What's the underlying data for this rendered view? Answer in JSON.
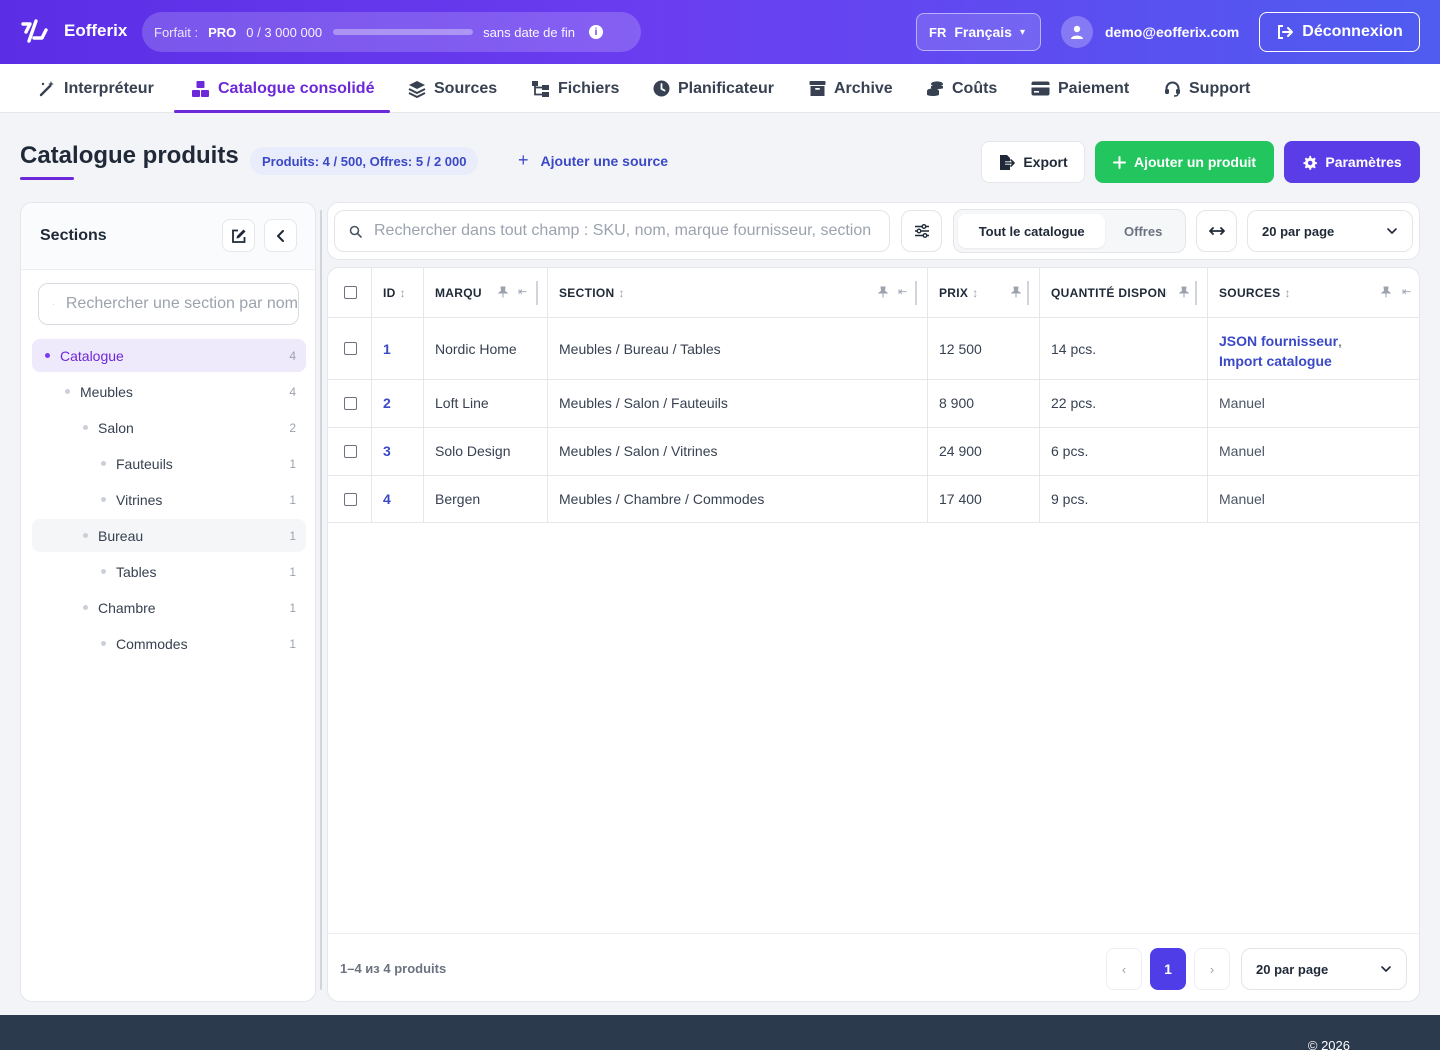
{
  "app": {
    "name": "Eofferix"
  },
  "plan": {
    "label": "Forfait :",
    "tier": "PRO",
    "usage": "0  /  3 000 000",
    "usage_fraction": 0.0,
    "expiry": "sans date de fin",
    "info": "i"
  },
  "lang": {
    "code": "FR",
    "label": "Français",
    "caret": "▾"
  },
  "user": {
    "email": "demo@eofferix.com"
  },
  "logout": {
    "label": "Déconnexion"
  },
  "nav": [
    {
      "label": "Interpréteur",
      "icon": "wand-icon"
    },
    {
      "label": "Catalogue consolidé",
      "icon": "boxes-icon",
      "active": true
    },
    {
      "label": "Sources",
      "icon": "layers-icon"
    },
    {
      "label": "Fichiers",
      "icon": "file-tree-icon"
    },
    {
      "label": "Planificateur",
      "icon": "clock-icon"
    },
    {
      "label": "Archive",
      "icon": "archive-icon"
    },
    {
      "label": "Coûts",
      "icon": "coins-icon"
    },
    {
      "label": "Paiement",
      "icon": "credit-card-icon"
    },
    {
      "label": "Support",
      "icon": "headset-icon"
    }
  ],
  "page": {
    "title": "Catalogue produits",
    "stats": "Produits: 4 / 500, Offres: 5 / 2 000",
    "add_source": "Ajouter une source",
    "add_source_symbol": "+",
    "export": "Export",
    "add_product": "Ajouter un produit",
    "settings": "Paramètres"
  },
  "sidebar": {
    "title": "Sections",
    "search_placeholder": "Rechercher une section par nom",
    "tree": [
      {
        "label": "Catalogue",
        "count": "4",
        "level": 0,
        "selected": true
      },
      {
        "label": "Meubles",
        "count": "4",
        "level": 1
      },
      {
        "label": "Salon",
        "count": "2",
        "level": 2
      },
      {
        "label": "Fauteuils",
        "count": "1",
        "level": 3
      },
      {
        "label": "Vitrines",
        "count": "1",
        "level": 3
      },
      {
        "label": "Bureau",
        "count": "1",
        "level": 2,
        "hover": true
      },
      {
        "label": "Tables",
        "count": "1",
        "level": 3
      },
      {
        "label": "Chambre",
        "count": "1",
        "level": 2
      },
      {
        "label": "Commodes",
        "count": "1",
        "level": 3
      }
    ]
  },
  "toolbar": {
    "search_placeholder": "Rechercher dans tout champ : SKU, nom, marque fournisseur, section",
    "scope": [
      "Tout le catalogue",
      "Offres"
    ],
    "per_page": "20 par page"
  },
  "table": {
    "columns": [
      "ID",
      "MARQU",
      "SECTION",
      "PRIX",
      "QUANTITÉ DISPONIBLE",
      "SOURCES"
    ],
    "sort_symbol": "↕",
    "rows": [
      {
        "id": "1",
        "brand": "Nordic Home",
        "section": "Meubles / Bureau / Tables",
        "price": "12 500",
        "qty": "14 pcs.",
        "sources": [
          "JSON fournisseur",
          "Import catalogue"
        ],
        "sep": ","
      },
      {
        "id": "2",
        "brand": "Loft Line",
        "section": "Meubles / Salon / Fauteuils",
        "price": "8 900",
        "qty": "22 pcs.",
        "sources_text": "Manuel"
      },
      {
        "id": "3",
        "brand": "Solo Design",
        "section": "Meubles / Salon / Vitrines",
        "price": "24 900",
        "qty": "6 pcs.",
        "sources_text": "Manuel"
      },
      {
        "id": "4",
        "brand": "Bergen",
        "section": "Meubles / Chambre / Commodes",
        "price": "17 400",
        "qty": "9 pcs.",
        "sources_text": "Manuel"
      }
    ]
  },
  "pagination": {
    "summary": "1–4 из 4 produits",
    "prev": "‹",
    "current": "1",
    "next": "›",
    "per_page": "20 par page"
  },
  "footer": {
    "copyright": "© 2026"
  },
  "colors": {
    "accent": "#6d28d9",
    "primary": "#5b3de8",
    "success": "#22c55e",
    "link": "#3b49c6"
  }
}
